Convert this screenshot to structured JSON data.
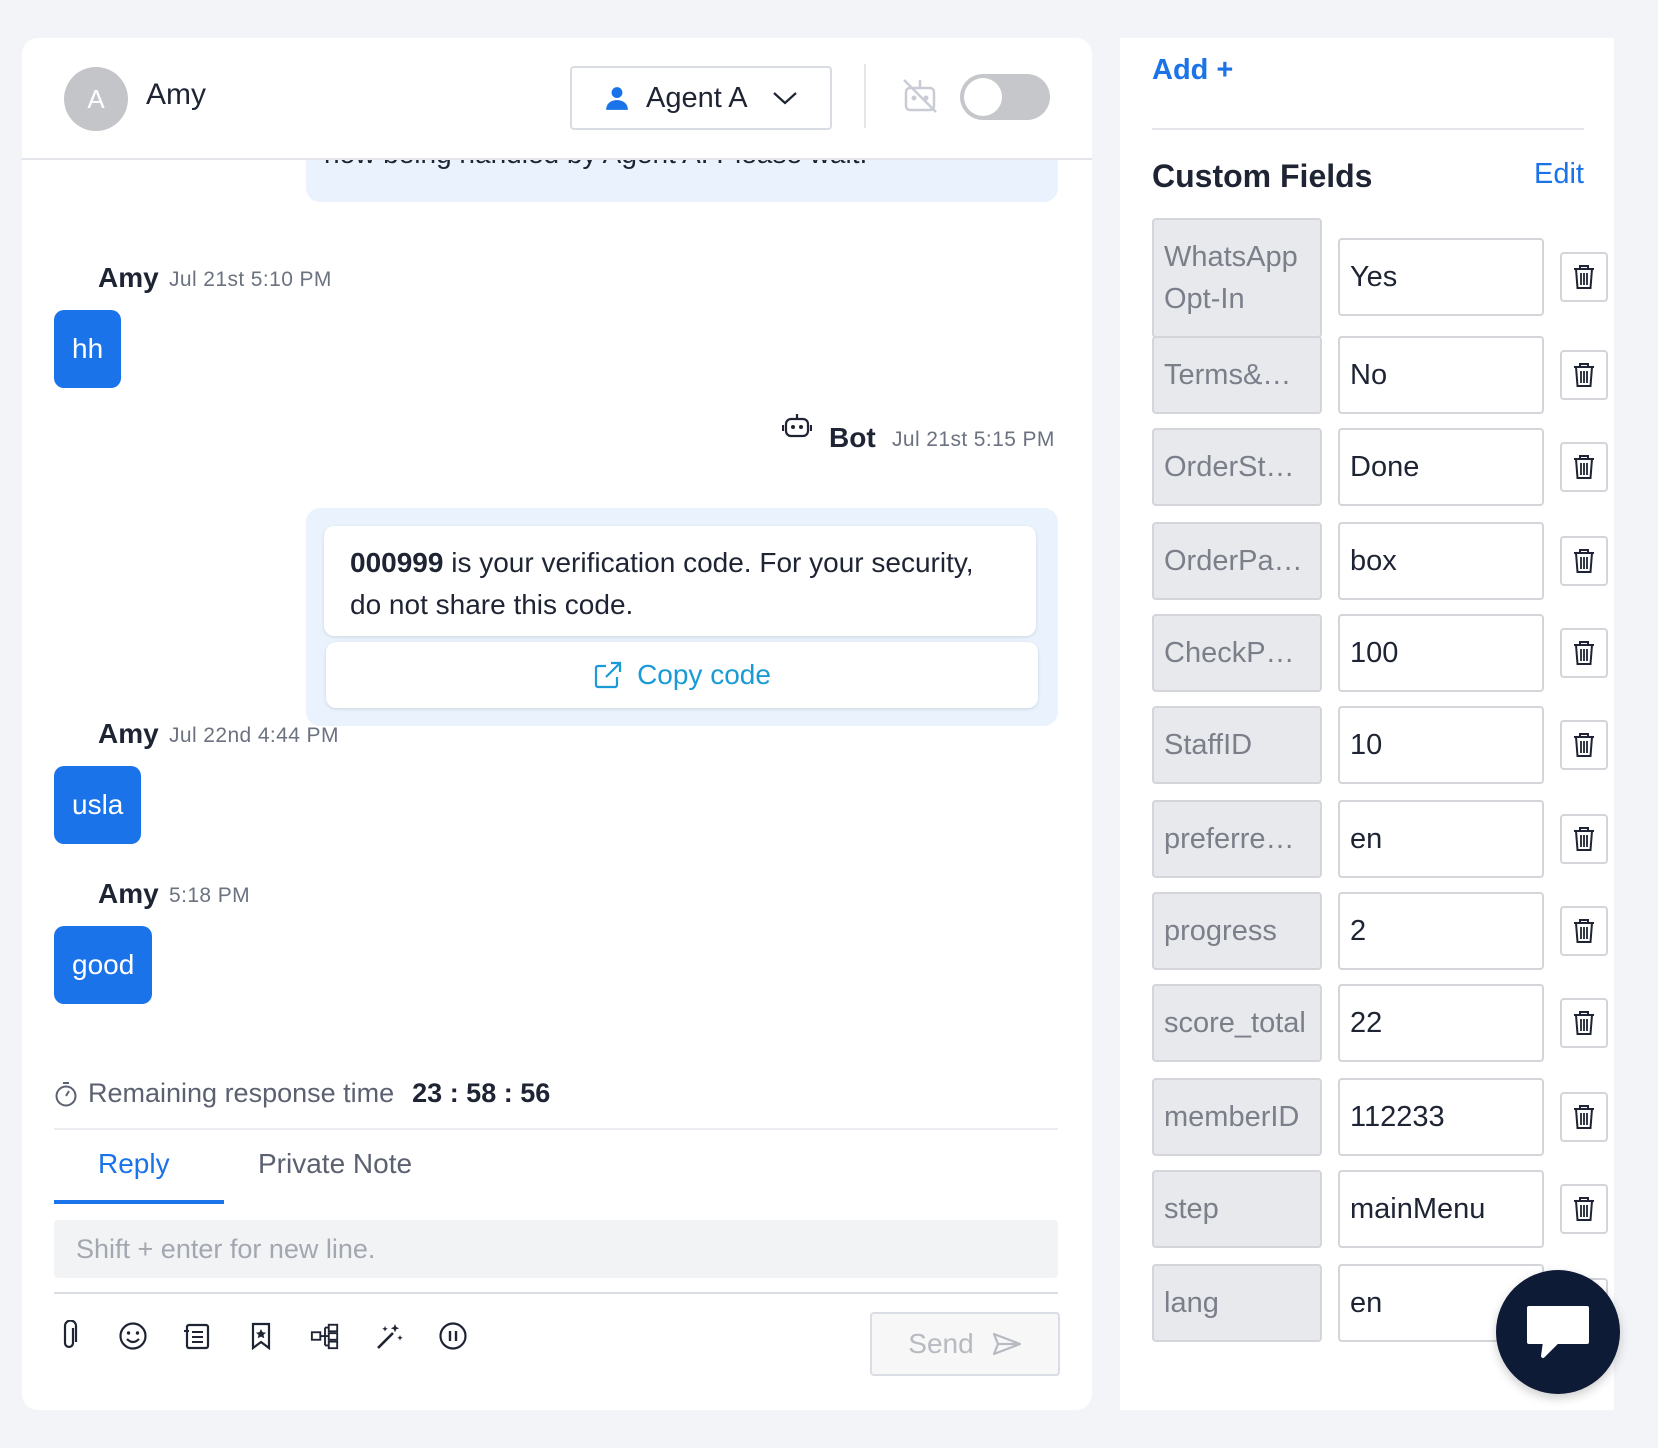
{
  "header": {
    "avatar_initial": "A",
    "contact_name": "Amy",
    "agent_label": "Agent A",
    "bot_toggle_on": false
  },
  "messages": {
    "partial_text": "now being handled by Agent A. Please wait.",
    "m1": {
      "sender": "Amy",
      "time": "Jul 21st 5:10 PM",
      "text": "hh"
    },
    "bot": {
      "sender": "Bot",
      "time": "Jul 21st 5:15 PM",
      "code": "000999",
      "text": " is your verification code. For your security, do not share this code.",
      "button_label": "Copy code"
    },
    "m2": {
      "sender": "Amy",
      "time": "Jul 22nd 4:44 PM",
      "text": "usla"
    },
    "m3": {
      "sender": "Amy",
      "time": "5:18 PM",
      "text": "good"
    }
  },
  "composer": {
    "timer_label": "Remaining response time",
    "timer_value": "23 : 58 : 56",
    "tabs": [
      "Reply",
      "Private Note"
    ],
    "active_tab": "Reply",
    "placeholder": "Shift + enter for new line.",
    "send_label": "Send",
    "tools": [
      "paperclip-icon",
      "emoji-icon",
      "template-icon",
      "bookmark-icon",
      "flow-icon",
      "magic-wand-icon",
      "pause-icon"
    ]
  },
  "side": {
    "add_label": "Add +",
    "title": "Custom Fields",
    "edit_label": "Edit",
    "fields": [
      {
        "key": "WhatsApp Opt-In",
        "value": "Yes"
      },
      {
        "key": "Terms&Conditions",
        "value": "No"
      },
      {
        "key": "OrderStatus",
        "value": "Done"
      },
      {
        "key": "OrderPackage",
        "value": "box"
      },
      {
        "key": "CheckPoint",
        "value": "100"
      },
      {
        "key": "StaffID",
        "value": "10"
      },
      {
        "key": "preferredLanguage",
        "value": "en"
      },
      {
        "key": "progress",
        "value": "2"
      },
      {
        "key": "score_total",
        "value": "22"
      },
      {
        "key": "memberID",
        "value": "112233"
      },
      {
        "key": "step",
        "value": "mainMenu"
      },
      {
        "key": "lang",
        "value": "en"
      }
    ]
  },
  "colors": {
    "accent": "#1a73e8",
    "bubble_light": "#e9f2fd",
    "copy_link": "#1a9ad6",
    "fab": "#0d1b36"
  }
}
